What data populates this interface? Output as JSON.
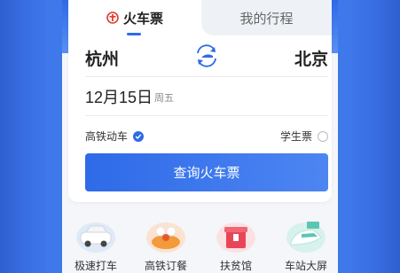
{
  "tabs": {
    "active": "火车票",
    "inactive": "我的行程"
  },
  "route": {
    "from": "杭州",
    "to": "北京"
  },
  "date": {
    "day": "12月15日",
    "weekday": "周五"
  },
  "options": {
    "high_speed": "高铁动车",
    "high_speed_checked": true,
    "student": "学生票",
    "student_checked": false
  },
  "query_button": "查询火车票",
  "services": [
    {
      "label": "极速打车",
      "icon": "car-icon"
    },
    {
      "label": "高铁订餐",
      "icon": "meal-icon"
    },
    {
      "label": "扶贫馆",
      "icon": "gift-shop-icon"
    },
    {
      "label": "车站大屏",
      "icon": "train-screen-icon"
    }
  ],
  "colors": {
    "accent": "#2f6ae8",
    "brand_red": "#e23b2e",
    "background": "#3f78ea"
  }
}
